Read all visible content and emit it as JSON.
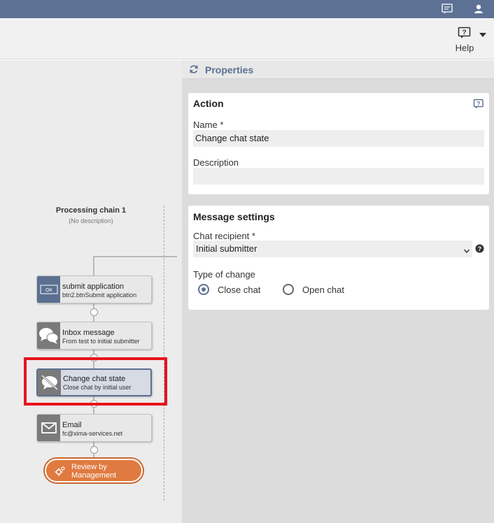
{
  "topbar": {
    "chat_icon": "message-square-icon",
    "user_icon": "user-icon",
    "color": "#5c7194"
  },
  "toolbar": {
    "help_label": "Help",
    "help_icon": "help-question-icon"
  },
  "canvas": {
    "chain_title": "Processing chain 1",
    "chain_description": "(No description)",
    "nodes": [
      {
        "title": "submit application",
        "subtitle": "btn2.btnSubmit application",
        "icon": "button-ok-icon",
        "icon_text": "OK"
      },
      {
        "title": "Inbox message",
        "subtitle": "From test to initial submitter",
        "icon": "chat-bubbles-icon"
      },
      {
        "title": "Change chat state",
        "subtitle": "Close chat by initial user",
        "icon": "chat-off-icon"
      },
      {
        "title": "Email",
        "subtitle": "fc@xima-services.net",
        "icon": "envelope-icon"
      }
    ],
    "review_button": {
      "label": "Review by Management",
      "icon": "gears-icon",
      "color": "#e07a40"
    }
  },
  "properties": {
    "title": "Properties",
    "action_card": {
      "title": "Action",
      "name_label": "Name",
      "required_marker": "*",
      "name_value": "Change chat state",
      "description_label": "Description",
      "description_value": ""
    },
    "message_card": {
      "title": "Message settings",
      "recipient_label": "Chat recipient",
      "required_marker": "*",
      "recipient_value": "Initial submitter",
      "type_label": "Type of change",
      "options": [
        {
          "label": "Close chat",
          "checked": true
        },
        {
          "label": "Open chat",
          "checked": false
        }
      ]
    }
  }
}
